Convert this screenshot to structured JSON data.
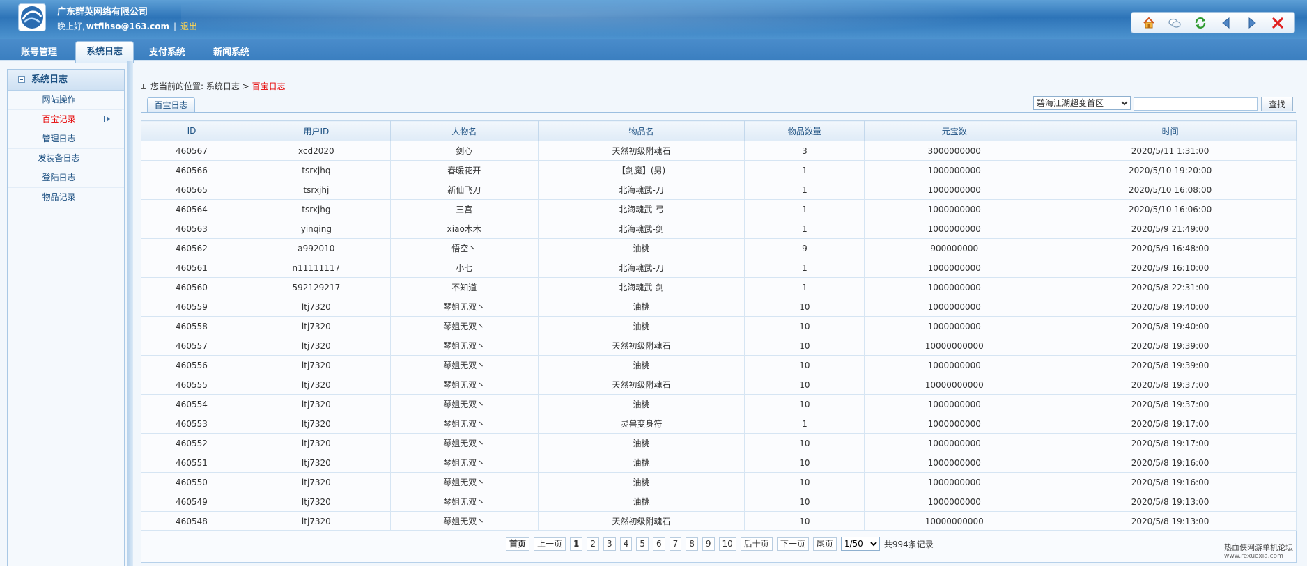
{
  "header": {
    "company": "广东群英网络有限公司",
    "greeting": "晚上好,",
    "user": "wtfihso@163.com",
    "separator": "|",
    "logout": "退出"
  },
  "toolbar": {
    "icons": [
      "home-icon",
      "chat-icon",
      "refresh-icon",
      "back-icon",
      "forward-icon",
      "close-icon"
    ]
  },
  "tabs": [
    {
      "label": "账号管理"
    },
    {
      "label": "系统日志"
    },
    {
      "label": "支付系统"
    },
    {
      "label": "新闻系统"
    }
  ],
  "sidebar": {
    "title": "系统日志",
    "items": [
      {
        "label": "网站操作"
      },
      {
        "label": "百宝记录"
      },
      {
        "label": "管理日志"
      },
      {
        "label": "发装备日志"
      },
      {
        "label": "登陆日志"
      },
      {
        "label": "物品记录"
      }
    ]
  },
  "breadcrumb": {
    "prefix": "您当前的位置:",
    "path": "系统日志",
    "arrow": ">",
    "current": "百宝日志"
  },
  "subtab": "百宝日志",
  "filter": {
    "server": "碧海江湖超变首区",
    "search_value": "",
    "search_button": "查找"
  },
  "table": {
    "columns": [
      "ID",
      "用户ID",
      "人物名",
      "物品名",
      "物品数量",
      "元宝数",
      "时间"
    ],
    "rows": [
      [
        "460567",
        "xcd2020",
        "剑心",
        "天然初级附魂石",
        "3",
        "3000000000",
        "2020/5/11 1:31:00"
      ],
      [
        "460566",
        "tsrxjhq",
        "春暖花开",
        "【剑魔】(男)",
        "1",
        "1000000000",
        "2020/5/10 19:20:00"
      ],
      [
        "460565",
        "tsrxjhj",
        "新仙飞刀",
        "北海魂武-刀",
        "1",
        "1000000000",
        "2020/5/10 16:08:00"
      ],
      [
        "460564",
        "tsrxjhg",
        "三宫",
        "北海魂武-弓",
        "1",
        "1000000000",
        "2020/5/10 16:06:00"
      ],
      [
        "460563",
        "yinqing",
        "xiao木木",
        "北海魂武-剑",
        "1",
        "1000000000",
        "2020/5/9 21:49:00"
      ],
      [
        "460562",
        "a992010",
        "悟空丶",
        "油桃",
        "9",
        "900000000",
        "2020/5/9 16:48:00"
      ],
      [
        "460561",
        "n11111117",
        "小七",
        "北海魂武-刀",
        "1",
        "1000000000",
        "2020/5/9 16:10:00"
      ],
      [
        "460560",
        "592129217",
        "不知道",
        "北海魂武-剑",
        "1",
        "1000000000",
        "2020/5/8 22:31:00"
      ],
      [
        "460559",
        "ltj7320",
        "琴姐无双丶",
        "油桃",
        "10",
        "1000000000",
        "2020/5/8 19:40:00"
      ],
      [
        "460558",
        "ltj7320",
        "琴姐无双丶",
        "油桃",
        "10",
        "1000000000",
        "2020/5/8 19:40:00"
      ],
      [
        "460557",
        "ltj7320",
        "琴姐无双丶",
        "天然初级附魂石",
        "10",
        "10000000000",
        "2020/5/8 19:39:00"
      ],
      [
        "460556",
        "ltj7320",
        "琴姐无双丶",
        "油桃",
        "10",
        "1000000000",
        "2020/5/8 19:39:00"
      ],
      [
        "460555",
        "ltj7320",
        "琴姐无双丶",
        "天然初级附魂石",
        "10",
        "10000000000",
        "2020/5/8 19:37:00"
      ],
      [
        "460554",
        "ltj7320",
        "琴姐无双丶",
        "油桃",
        "10",
        "1000000000",
        "2020/5/8 19:37:00"
      ],
      [
        "460553",
        "ltj7320",
        "琴姐无双丶",
        "灵兽变身符",
        "1",
        "1000000000",
        "2020/5/8 19:17:00"
      ],
      [
        "460552",
        "ltj7320",
        "琴姐无双丶",
        "油桃",
        "10",
        "1000000000",
        "2020/5/8 19:17:00"
      ],
      [
        "460551",
        "ltj7320",
        "琴姐无双丶",
        "油桃",
        "10",
        "1000000000",
        "2020/5/8 19:16:00"
      ],
      [
        "460550",
        "ltj7320",
        "琴姐无双丶",
        "油桃",
        "10",
        "1000000000",
        "2020/5/8 19:16:00"
      ],
      [
        "460549",
        "ltj7320",
        "琴姐无双丶",
        "油桃",
        "10",
        "1000000000",
        "2020/5/8 19:13:00"
      ],
      [
        "460548",
        "ltj7320",
        "琴姐无双丶",
        "天然初级附魂石",
        "10",
        "10000000000",
        "2020/5/8 19:13:00"
      ]
    ]
  },
  "pager": {
    "first": "首页",
    "prev": "上一页",
    "pages": [
      "1",
      "2",
      "3",
      "4",
      "5",
      "6",
      "7",
      "8",
      "9",
      "10"
    ],
    "current": "1",
    "next_ten": "后十页",
    "next": "下一页",
    "last": "尾页",
    "page_select": "1/50",
    "total": "共994条记录"
  },
  "footer_mark": {
    "line1": "热血侠网游单机论坛",
    "line2": "www.rexuexia.com"
  },
  "colors": {
    "header_blue": "#2d74b8",
    "tab_bar": "#3b7fc0",
    "accent_red": "#e60000",
    "link_blue": "#1b4f81",
    "logout_yellow": "#ffd34d"
  }
}
